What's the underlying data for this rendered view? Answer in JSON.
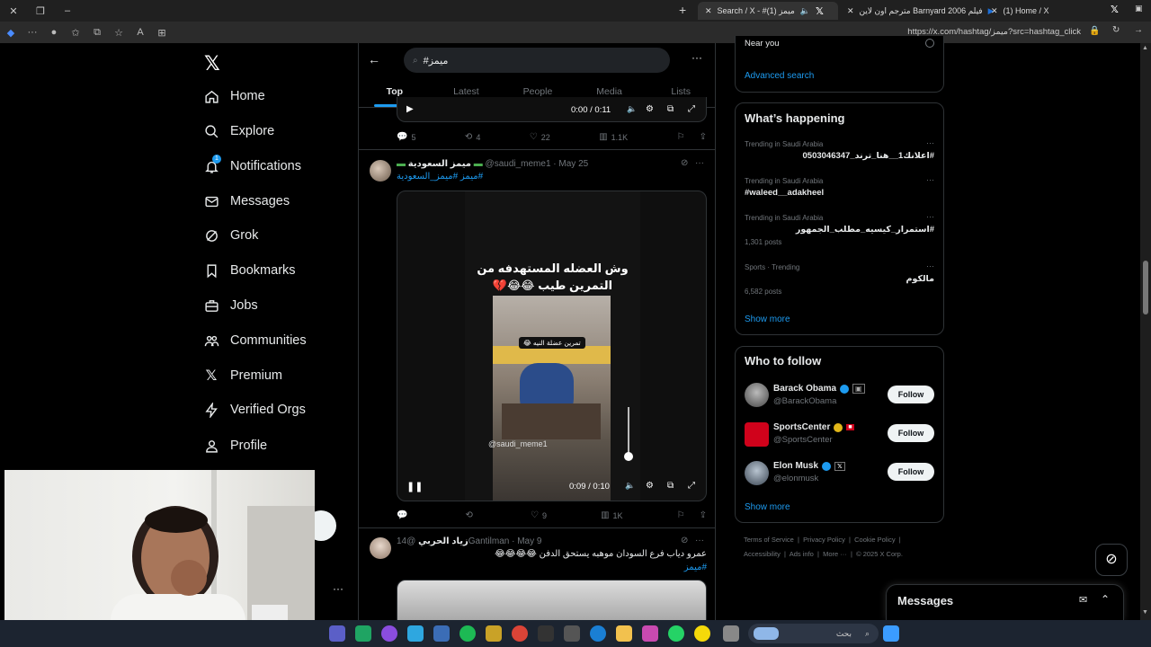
{
  "browser": {
    "tabs": [
      {
        "title": "Search / X - #ميمز (1)",
        "active": true
      },
      {
        "title": "فيلم Barnyard 2006 مترجم اون لاين",
        "active": false
      },
      {
        "title": "(1) Home / X",
        "active": false
      }
    ],
    "url": "https://x.com/hashtag/ميمز?src=hashtag_click"
  },
  "nav": {
    "items": [
      {
        "label": "Home",
        "icon": "home-icon"
      },
      {
        "label": "Explore",
        "icon": "search-icon"
      },
      {
        "label": "Notifications",
        "icon": "bell-icon",
        "badge": "1"
      },
      {
        "label": "Messages",
        "icon": "envelope-icon"
      },
      {
        "label": "Grok",
        "icon": "grok-icon"
      },
      {
        "label": "Bookmarks",
        "icon": "bookmark-icon"
      },
      {
        "label": "Jobs",
        "icon": "briefcase-icon"
      },
      {
        "label": "Communities",
        "icon": "people-icon"
      },
      {
        "label": "Premium",
        "icon": "x-logo-icon"
      },
      {
        "label": "Verified Orgs",
        "icon": "lightning-icon"
      },
      {
        "label": "Profile",
        "icon": "person-icon"
      }
    ]
  },
  "search": {
    "query": "#ميمز"
  },
  "tabs": [
    "Top",
    "Latest",
    "People",
    "Media",
    "Lists"
  ],
  "tweets": [
    {
      "video_time": "0:00 / 0:11",
      "replies": "5",
      "reposts": "4",
      "likes": "22",
      "views": "1.1K"
    },
    {
      "name": "ميمز السعودية",
      "handle": "@saudi_meme1",
      "date": "May 25",
      "hashtags": "#ميمز #ميمز_السعودية",
      "video_caption": "وش العضله المستهدفه من التمرين طيب 😂😂💔",
      "video_inner_label": "تمرين عضلة النيه 😂",
      "watermark": "@saudi_meme1",
      "video_time": "0:09 / 0:10",
      "replies": "",
      "reposts": "",
      "likes": "9",
      "views": "1K"
    },
    {
      "name": "زياد الحربي",
      "handle": "@14Gantilman",
      "date": "May 9",
      "text": "عمرو دياب فرع السودان موهبه يستحق الدفن 😂😂😂😂",
      "hashtags": "#ميمز"
    }
  ],
  "right": {
    "near_you": "Near you",
    "advanced_search": "Advanced search",
    "happening_title": "What’s happening",
    "trends": [
      {
        "meta": "Trending in Saudi Arabia",
        "name": "#اعلانك1__هنا_ترند_0503046347",
        "count": ""
      },
      {
        "meta": "Trending in Saudi Arabia",
        "name": "#waleed__adakheel",
        "count": ""
      },
      {
        "meta": "Trending in Saudi Arabia",
        "name": "#استمرار_كيسيه_مطلب_الجمهور",
        "count": "1,301 posts"
      },
      {
        "meta": "Sports · Trending",
        "name": "مالكوم",
        "count": "6,582 posts"
      }
    ],
    "show_more": "Show more",
    "wtf_title": "Who to follow",
    "follow_label": "Follow",
    "who_to_follow": [
      {
        "name": "Barack Obama",
        "handle": "@BarackObama",
        "badge_color": "#1d9bf0"
      },
      {
        "name": "SportsCenter",
        "handle": "@SportsCenter",
        "badge_color": "#e2b719"
      },
      {
        "name": "Elon Musk",
        "handle": "@elonmusk",
        "badge_color": "#1d9bf0"
      }
    ],
    "show_more_2": "Show more",
    "footer": [
      "Terms of Service",
      "Privacy Policy",
      "Cookie Policy",
      "Accessibility",
      "Ads info",
      "More ···",
      "© 2025 X Corp."
    ]
  },
  "messages_dock": {
    "title": "Messages"
  },
  "taskbar": {
    "search_placeholder": "بحث"
  },
  "colors": {
    "accent": "#1d9bf0",
    "background": "#000000",
    "border": "#2f3336",
    "muted": "#71767b"
  }
}
